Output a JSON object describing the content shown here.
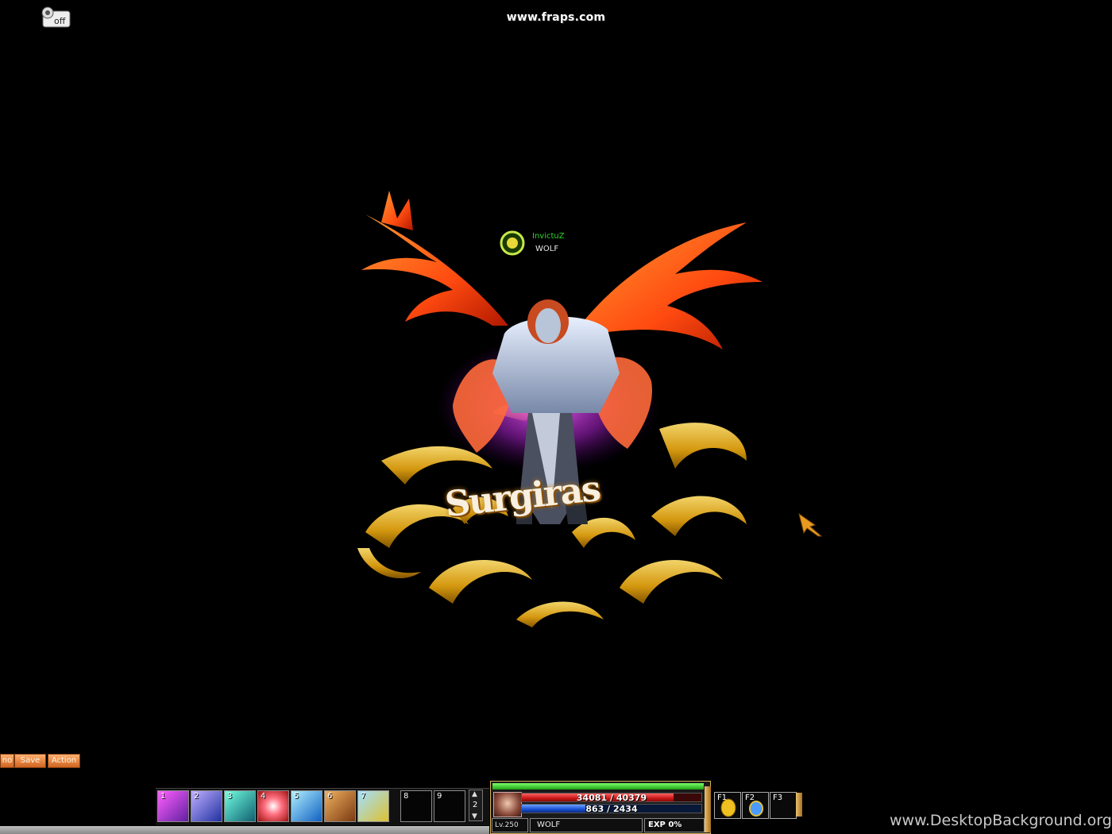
{
  "overlay": {
    "recording_watermark": "www.fraps.com",
    "site_watermark": "www.DesktopBackground.org",
    "fraps_icon_label": "off"
  },
  "character": {
    "player_name": "InvictuZ",
    "guild_name": "WOLF",
    "emblem_text": "Surgiras"
  },
  "quick_menu": {
    "partial_label": "no",
    "save_label": "Save",
    "action_label": "Action"
  },
  "skillbar": {
    "slots": [
      {
        "key": "1",
        "icon": "purple-slash-skill-icon"
      },
      {
        "key": "2",
        "icon": "blue-warrior-skill-icon"
      },
      {
        "key": "3",
        "icon": "teal-spirit-skill-icon"
      },
      {
        "key": "4",
        "icon": "red-orb-skill-icon"
      },
      {
        "key": "5",
        "icon": "ice-claw-skill-icon"
      },
      {
        "key": "6",
        "icon": "shield-buff-skill-icon"
      },
      {
        "key": "7",
        "icon": "gold-aura-skill-icon"
      },
      {
        "key": "8",
        "icon": ""
      },
      {
        "key": "9",
        "icon": ""
      }
    ],
    "page": "2"
  },
  "status": {
    "hp_text": "34081 / 40379",
    "hp_fraction": 0.844,
    "mp_text": "863 / 2434",
    "mp_fraction": 0.355,
    "top_gauge_fraction": 1.0,
    "level": "Lv.250",
    "name": "WOLF",
    "exp": "EXP 0%"
  },
  "function_keys": [
    {
      "key": "F1",
      "icon": "gold-potion-icon"
    },
    {
      "key": "F2",
      "icon": "blue-potion-icon"
    },
    {
      "key": "F3",
      "icon": ""
    }
  ],
  "colors": {
    "hp": "#c81818",
    "mp": "#1850d0",
    "player_name": "#2bd62b",
    "panel_trim": "#d9b45a"
  }
}
